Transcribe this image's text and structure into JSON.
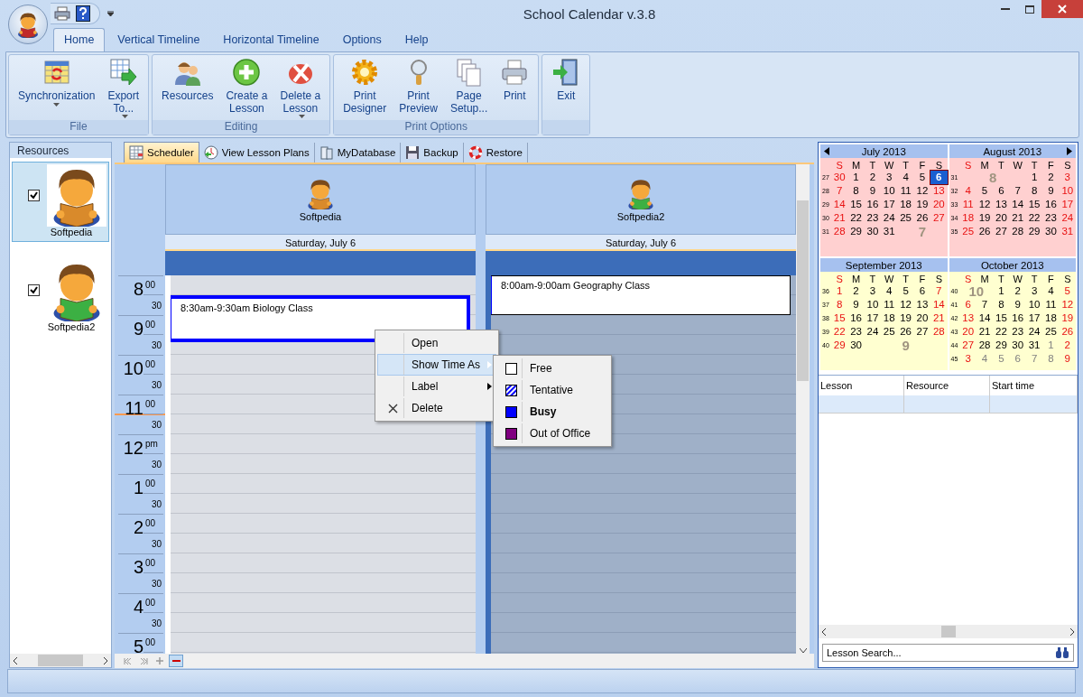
{
  "window": {
    "title": "School Calendar v.3.8"
  },
  "ribbon_tabs": [
    {
      "label": "Home",
      "selected": true
    },
    {
      "label": "Vertical Timeline",
      "selected": false
    },
    {
      "label": "Horizontal Timeline",
      "selected": false
    },
    {
      "label": "Options",
      "selected": false
    },
    {
      "label": "Help",
      "selected": false
    }
  ],
  "ribbon_groups": [
    {
      "label": "File",
      "buttons": [
        {
          "kind": "sync",
          "lines": [
            "Synchronization"
          ],
          "dropdown": true
        },
        {
          "kind": "export",
          "lines": [
            "Export",
            "To..."
          ],
          "dropdown": true
        }
      ]
    },
    {
      "label": "Editing",
      "buttons": [
        {
          "kind": "resources",
          "lines": [
            "Resources"
          ],
          "dropdown": false
        },
        {
          "kind": "create",
          "lines": [
            "Create a",
            "Lesson"
          ],
          "dropdown": false
        },
        {
          "kind": "delete",
          "lines": [
            "Delete a",
            "Lesson"
          ],
          "dropdown": true
        }
      ]
    },
    {
      "label": "Print Options",
      "buttons": [
        {
          "kind": "designer",
          "lines": [
            "Print",
            "Designer"
          ],
          "dropdown": false
        },
        {
          "kind": "preview",
          "lines": [
            "Print",
            "Preview"
          ],
          "dropdown": false
        },
        {
          "kind": "pagesetup",
          "lines": [
            "Page",
            "Setup..."
          ],
          "dropdown": false
        },
        {
          "kind": "print",
          "lines": [
            "Print"
          ],
          "dropdown": false
        }
      ]
    },
    {
      "buttons": [
        {
          "kind": "exit",
          "lines": [
            "Exit"
          ],
          "dropdown": false
        }
      ]
    }
  ],
  "resources_panel": {
    "title": "Resources",
    "items": [
      {
        "name": "Softpedia",
        "checked": true,
        "selected": true,
        "color": "#d98a2b"
      },
      {
        "name": "Softpedia2",
        "checked": true,
        "selected": false,
        "color": "#3cb043"
      }
    ]
  },
  "view_tabs": [
    {
      "kind": "scheduler",
      "label": "Scheduler",
      "selected": true
    },
    {
      "kind": "plans",
      "label": "View Lesson Plans",
      "selected": false
    },
    {
      "kind": "database",
      "label": "MyDatabase",
      "selected": false
    },
    {
      "kind": "backup",
      "label": "Backup",
      "selected": false
    },
    {
      "kind": "restore",
      "label": "Restore",
      "selected": false
    }
  ],
  "time_rows": [
    {
      "hour": "8",
      "suffix": "00",
      "half": "30",
      "current": false
    },
    {
      "hour": "9",
      "suffix": "00",
      "half": "30",
      "current": false
    },
    {
      "hour": "10",
      "suffix": "00",
      "half": "30",
      "current": false
    },
    {
      "hour": "11",
      "suffix": "00",
      "half": "30",
      "current": true
    },
    {
      "hour": "12",
      "suffix": "pm",
      "half": "30",
      "current": false
    },
    {
      "hour": "1",
      "suffix": "00",
      "half": "30",
      "current": false
    },
    {
      "hour": "2",
      "suffix": "00",
      "half": "30",
      "current": false
    },
    {
      "hour": "3",
      "suffix": "00",
      "half": "30",
      "current": false
    },
    {
      "hour": "4",
      "suffix": "00",
      "half": "30",
      "current": false
    },
    {
      "hour": "5",
      "suffix": "00",
      "current": false
    }
  ],
  "columns": [
    {
      "name": "Softpedia",
      "color": "#d98a2b",
      "date": "Saturday, July 6",
      "shaded": false,
      "appointments": [
        {
          "kind": "busy",
          "text": "8:30am-9:30am Biology Class",
          "selected": true
        }
      ]
    },
    {
      "name": "Softpedia2",
      "color": "#3cb043",
      "date": "Saturday, July 6",
      "shaded": true,
      "appointments": [
        {
          "kind": "busy",
          "text": "8:00am-9:00am Geography Class",
          "selected": false
        }
      ]
    }
  ],
  "context_menu": {
    "items": [
      {
        "kind": "plain",
        "label": "Open",
        "selected": false,
        "submenu": false
      },
      {
        "kind": "plain",
        "label": "Show Time As",
        "selected": true,
        "submenu": true
      },
      {
        "kind": "plain",
        "label": "Label",
        "selected": false,
        "submenu": true
      },
      {
        "kind": "delete",
        "label": "Delete",
        "selected": false,
        "submenu": false
      }
    ],
    "submenu": [
      {
        "kind": "free",
        "label": "Free",
        "selected": false
      },
      {
        "kind": "tentative",
        "label": "Tentative",
        "selected": false
      },
      {
        "kind": "busy",
        "label": "Busy",
        "selected": true
      },
      {
        "kind": "oof",
        "label": "Out of Office",
        "selected": false
      }
    ]
  },
  "calendar": {
    "months": [
      {
        "title": "July 2013",
        "watermark": "7",
        "prev_button": true,
        "next_button": false,
        "color": "#ffd0d0",
        "weekdays": [
          "S",
          "M",
          "T",
          "W",
          "T",
          "F",
          "S"
        ],
        "weeks": [
          {
            "number": "27",
            "days": [
              {
                "kind": "weekend",
                "d": "30",
                "selected": false
              },
              {
                "kind": "day",
                "d": "1",
                "selected": false
              },
              {
                "kind": "day",
                "d": "2",
                "selected": false
              },
              {
                "kind": "day",
                "d": "3",
                "selected": false
              },
              {
                "kind": "day",
                "d": "4",
                "selected": false
              },
              {
                "kind": "day",
                "d": "5",
                "selected": false
              },
              {
                "kind": "weekend",
                "d": "6",
                "selected": true
              }
            ]
          },
          {
            "number": "28",
            "days": [
              {
                "kind": "weekend",
                "d": "7",
                "selected": false
              },
              {
                "kind": "day",
                "d": "8",
                "selected": false
              },
              {
                "kind": "day",
                "d": "9",
                "selected": false
              },
              {
                "kind": "day",
                "d": "10",
                "selected": false
              },
              {
                "kind": "day",
                "d": "11",
                "selected": false
              },
              {
                "kind": "day",
                "d": "12",
                "selected": false
              },
              {
                "kind": "weekend",
                "d": "13",
                "selected": false
              }
            ]
          },
          {
            "number": "29",
            "days": [
              {
                "kind": "weekend",
                "d": "14",
                "selected": false
              },
              {
                "kind": "day",
                "d": "15",
                "selected": false
              },
              {
                "kind": "day",
                "d": "16",
                "selected": false
              },
              {
                "kind": "day",
                "d": "17",
                "selected": false
              },
              {
                "kind": "day",
                "d": "18",
                "selected": false
              },
              {
                "kind": "day",
                "d": "19",
                "selected": false
              },
              {
                "kind": "weekend",
                "d": "20",
                "selected": false
              }
            ]
          },
          {
            "number": "30",
            "days": [
              {
                "kind": "weekend",
                "d": "21",
                "selected": false
              },
              {
                "kind": "day",
                "d": "22",
                "selected": false
              },
              {
                "kind": "day",
                "d": "23",
                "selected": false
              },
              {
                "kind": "day",
                "d": "24",
                "selected": false
              },
              {
                "kind": "day",
                "d": "25",
                "selected": false
              },
              {
                "kind": "day",
                "d": "26",
                "selected": false
              },
              {
                "kind": "weekend",
                "d": "27",
                "selected": false
              }
            ]
          },
          {
            "number": "31",
            "days": [
              {
                "kind": "weekend",
                "d": "28",
                "selected": false
              },
              {
                "kind": "day",
                "d": "29",
                "selected": false
              },
              {
                "kind": "day",
                "d": "30",
                "selected": false
              },
              {
                "kind": "day",
                "d": "31",
                "selected": false
              },
              {
                "kind": "blank"
              },
              {
                "kind": "blank"
              },
              {
                "kind": "blank"
              }
            ]
          }
        ]
      },
      {
        "title": "August 2013",
        "watermark": "8",
        "prev_button": false,
        "next_button": true,
        "color": "#ffd0d0",
        "weekdays": [
          "S",
          "M",
          "T",
          "W",
          "T",
          "F",
          "S"
        ],
        "weeks": [
          {
            "number": "31",
            "days": [
              {
                "kind": "blank"
              },
              {
                "kind": "blank"
              },
              {
                "kind": "blank"
              },
              {
                "kind": "blank"
              },
              {
                "kind": "day",
                "d": "1",
                "selected": false
              },
              {
                "kind": "day",
                "d": "2",
                "selected": false
              },
              {
                "kind": "weekend",
                "d": "3",
                "selected": false
              }
            ]
          },
          {
            "number": "32",
            "days": [
              {
                "kind": "weekend",
                "d": "4",
                "selected": false
              },
              {
                "kind": "day",
                "d": "5",
                "selected": false
              },
              {
                "kind": "day",
                "d": "6",
                "selected": false
              },
              {
                "kind": "day",
                "d": "7",
                "selected": false
              },
              {
                "kind": "day",
                "d": "8",
                "selected": false
              },
              {
                "kind": "day",
                "d": "9",
                "selected": false
              },
              {
                "kind": "weekend",
                "d": "10",
                "selected": false
              }
            ]
          },
          {
            "number": "33",
            "days": [
              {
                "kind": "weekend",
                "d": "11",
                "selected": false
              },
              {
                "kind": "day",
                "d": "12",
                "selected": false
              },
              {
                "kind": "day",
                "d": "13",
                "selected": false
              },
              {
                "kind": "day",
                "d": "14",
                "selected": false
              },
              {
                "kind": "day",
                "d": "15",
                "selected": false
              },
              {
                "kind": "day",
                "d": "16",
                "selected": false
              },
              {
                "kind": "weekend",
                "d": "17",
                "selected": false
              }
            ]
          },
          {
            "number": "34",
            "days": [
              {
                "kind": "weekend",
                "d": "18",
                "selected": false
              },
              {
                "kind": "day",
                "d": "19",
                "selected": false
              },
              {
                "kind": "day",
                "d": "20",
                "selected": false
              },
              {
                "kind": "day",
                "d": "21",
                "selected": false
              },
              {
                "kind": "day",
                "d": "22",
                "selected": false
              },
              {
                "kind": "day",
                "d": "23",
                "selected": false
              },
              {
                "kind": "weekend",
                "d": "24",
                "selected": false
              }
            ]
          },
          {
            "number": "35",
            "days": [
              {
                "kind": "weekend",
                "d": "25",
                "selected": false
              },
              {
                "kind": "day",
                "d": "26",
                "selected": false
              },
              {
                "kind": "day",
                "d": "27",
                "selected": false
              },
              {
                "kind": "day",
                "d": "28",
                "selected": false
              },
              {
                "kind": "day",
                "d": "29",
                "selected": false
              },
              {
                "kind": "day",
                "d": "30",
                "selected": false
              },
              {
                "kind": "weekend",
                "d": "31",
                "selected": false
              }
            ]
          }
        ]
      },
      {
        "title": "September 2013",
        "watermark": "9",
        "prev_button": false,
        "next_button": false,
        "color": "#ffffd0",
        "weekdays": [
          "S",
          "M",
          "T",
          "W",
          "T",
          "F",
          "S"
        ],
        "weeks": [
          {
            "number": "36",
            "days": [
              {
                "kind": "weekend",
                "d": "1",
                "selected": false
              },
              {
                "kind": "day",
                "d": "2",
                "selected": false
              },
              {
                "kind": "day",
                "d": "3",
                "selected": false
              },
              {
                "kind": "day",
                "d": "4",
                "selected": false
              },
              {
                "kind": "day",
                "d": "5",
                "selected": false
              },
              {
                "kind": "day",
                "d": "6",
                "selected": false
              },
              {
                "kind": "weekend",
                "d": "7",
                "selected": false
              }
            ]
          },
          {
            "number": "37",
            "days": [
              {
                "kind": "weekend",
                "d": "8",
                "selected": false
              },
              {
                "kind": "day",
                "d": "9",
                "selected": false
              },
              {
                "kind": "day",
                "d": "10",
                "selected": false
              },
              {
                "kind": "day",
                "d": "11",
                "selected": false
              },
              {
                "kind": "day",
                "d": "12",
                "selected": false
              },
              {
                "kind": "day",
                "d": "13",
                "selected": false
              },
              {
                "kind": "weekend",
                "d": "14",
                "selected": false
              }
            ]
          },
          {
            "number": "38",
            "days": [
              {
                "kind": "weekend",
                "d": "15",
                "selected": false
              },
              {
                "kind": "day",
                "d": "16",
                "selected": false
              },
              {
                "kind": "day",
                "d": "17",
                "selected": false
              },
              {
                "kind": "day",
                "d": "18",
                "selected": false
              },
              {
                "kind": "day",
                "d": "19",
                "selected": false
              },
              {
                "kind": "day",
                "d": "20",
                "selected": false
              },
              {
                "kind": "weekend",
                "d": "21",
                "selected": false
              }
            ]
          },
          {
            "number": "39",
            "days": [
              {
                "kind": "weekend",
                "d": "22",
                "selected": false
              },
              {
                "kind": "day",
                "d": "23",
                "selected": false
              },
              {
                "kind": "day",
                "d": "24",
                "selected": false
              },
              {
                "kind": "day",
                "d": "25",
                "selected": false
              },
              {
                "kind": "day",
                "d": "26",
                "selected": false
              },
              {
                "kind": "day",
                "d": "27",
                "selected": false
              },
              {
                "kind": "weekend",
                "d": "28",
                "selected": false
              }
            ]
          },
          {
            "number": "40",
            "days": [
              {
                "kind": "weekend",
                "d": "29",
                "selected": false
              },
              {
                "kind": "day",
                "d": "30",
                "selected": false
              },
              {
                "kind": "blank"
              },
              {
                "kind": "blank"
              },
              {
                "kind": "blank"
              },
              {
                "kind": "blank"
              },
              {
                "kind": "blank"
              }
            ]
          }
        ]
      },
      {
        "title": "October 2013",
        "watermark": "10",
        "prev_button": false,
        "next_button": false,
        "color": "#ffffd0",
        "weekdays": [
          "S",
          "M",
          "T",
          "W",
          "T",
          "F",
          "S"
        ],
        "weeks": [
          {
            "number": "40",
            "days": [
              {
                "kind": "blank"
              },
              {
                "kind": "blank"
              },
              {
                "kind": "day",
                "d": "1",
                "selected": false
              },
              {
                "kind": "day",
                "d": "2",
                "selected": false
              },
              {
                "kind": "day",
                "d": "3",
                "selected": false
              },
              {
                "kind": "day",
                "d": "4",
                "selected": false
              },
              {
                "kind": "weekend",
                "d": "5",
                "selected": false
              }
            ]
          },
          {
            "number": "41",
            "days": [
              {
                "kind": "weekend",
                "d": "6",
                "selected": false
              },
              {
                "kind": "day",
                "d": "7",
                "selected": false
              },
              {
                "kind": "day",
                "d": "8",
                "selected": false
              },
              {
                "kind": "day",
                "d": "9",
                "selected": false
              },
              {
                "kind": "day",
                "d": "10",
                "selected": false
              },
              {
                "kind": "day",
                "d": "11",
                "selected": false
              },
              {
                "kind": "weekend",
                "d": "12",
                "selected": false
              }
            ]
          },
          {
            "number": "42",
            "days": [
              {
                "kind": "weekend",
                "d": "13",
                "selected": false
              },
              {
                "kind": "day",
                "d": "14",
                "selected": false
              },
              {
                "kind": "day",
                "d": "15",
                "selected": false
              },
              {
                "kind": "day",
                "d": "16",
                "selected": false
              },
              {
                "kind": "day",
                "d": "17",
                "selected": false
              },
              {
                "kind": "day",
                "d": "18",
                "selected": false
              },
              {
                "kind": "weekend",
                "d": "19",
                "selected": false
              }
            ]
          },
          {
            "number": "43",
            "days": [
              {
                "kind": "weekend",
                "d": "20",
                "selected": false
              },
              {
                "kind": "day",
                "d": "21",
                "selected": false
              },
              {
                "kind": "day",
                "d": "22",
                "selected": false
              },
              {
                "kind": "day",
                "d": "23",
                "selected": false
              },
              {
                "kind": "day",
                "d": "24",
                "selected": false
              },
              {
                "kind": "day",
                "d": "25",
                "selected": false
              },
              {
                "kind": "weekend",
                "d": "26",
                "selected": false
              }
            ]
          },
          {
            "number": "44",
            "days": [
              {
                "kind": "weekend",
                "d": "27",
                "selected": false
              },
              {
                "kind": "day",
                "d": "28",
                "selected": false
              },
              {
                "kind": "day",
                "d": "29",
                "selected": false
              },
              {
                "kind": "day",
                "d": "30",
                "selected": false
              },
              {
                "kind": "day",
                "d": "31",
                "selected": false
              },
              {
                "kind": "other",
                "d": "1",
                "selected": false
              },
              {
                "kind": "weekend",
                "d": "2",
                "selected": false
              }
            ]
          },
          {
            "number": "45",
            "days": [
              {
                "kind": "weekend",
                "d": "3",
                "selected": false
              },
              {
                "kind": "other",
                "d": "4",
                "selected": false
              },
              {
                "kind": "other",
                "d": "5",
                "selected": false
              },
              {
                "kind": "other",
                "d": "6",
                "selected": false
              },
              {
                "kind": "other",
                "d": "7",
                "selected": false
              },
              {
                "kind": "other",
                "d": "8",
                "selected": false
              },
              {
                "kind": "weekend",
                "d": "9",
                "selected": false
              }
            ]
          }
        ]
      }
    ]
  },
  "lesson_table": {
    "columns": [
      "Lesson",
      "Resource",
      "Start time"
    ],
    "rows": [
      {
        "selected": true
      }
    ]
  },
  "lesson_search": {
    "placeholder": "Lesson Search..."
  }
}
